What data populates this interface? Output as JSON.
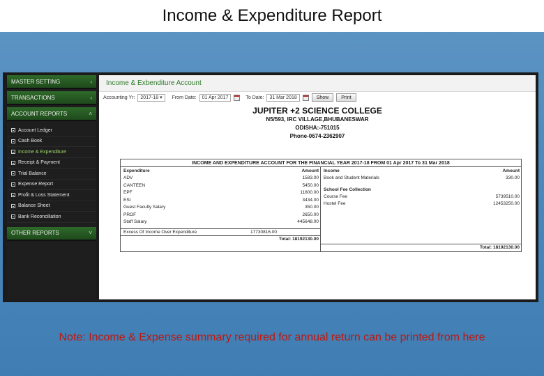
{
  "slide": {
    "title": "Income & Expenditure Report",
    "note": "Note: Income & Expense summary required for annual return can be printed from here"
  },
  "sidebar": {
    "sections": [
      {
        "label": "MASTER SETTING",
        "chevron": "chevron-right-icon"
      },
      {
        "label": "TRANSACTIONS",
        "chevron": "chevron-right-icon"
      },
      {
        "label": "ACCOUNT REPORTS",
        "chevron": "chevron-up-icon"
      }
    ],
    "items": [
      "Account Ledger",
      "Cash Book",
      "Income & Expenditure",
      "Receipt & Payment",
      "Trial Balance",
      "Expense Report",
      "Profit & Loss Statement",
      "Balance Sheet",
      "Bank Reconciliation"
    ],
    "active_item": "Income & Expenditure",
    "other": {
      "label": "OTHER REPORTS",
      "chevron": "chevron-down-icon"
    }
  },
  "page": {
    "title": "Income & Exbenditure Account"
  },
  "filters": {
    "accounting_yr_label": "Accounting Yr:",
    "accounting_yr_value": "2017-18",
    "from_label": "From Date:",
    "from_value": "01 Apr 2017",
    "to_label": "To Date:",
    "to_value": "31 Mar 2018",
    "show_label": "Show",
    "print_label": "Print"
  },
  "college": {
    "name": "JUPITER +2 SCIENCE COLLEGE",
    "address": "N5/593, IRC VILLAGE,BHUBANESWAR",
    "state": "ODISHA:-751015",
    "phone": "Phone-0674-2362907"
  },
  "report": {
    "title": "INCOME AND EXPENDITURE ACCOUNT FOR THE FINANCIAL YEAR 2017-18 FROM 01 Apr 2017 To 31 Mar 2018",
    "expenditure_header": "Expenditure",
    "income_header": "Income",
    "amount_header": "Amount",
    "expenditure": [
      {
        "name": "ADV",
        "amount": "1583.00"
      },
      {
        "name": "CANTEEN",
        "amount": "5450.00"
      },
      {
        "name": "EPF",
        "amount": "11800.00"
      },
      {
        "name": "ESI",
        "amount": "3434.00"
      },
      {
        "name": "Guest Faculty Salary",
        "amount": "350.00"
      },
      {
        "name": "PROF",
        "amount": "2650.00"
      },
      {
        "name": "Staff Salary",
        "amount": "445648.00"
      }
    ],
    "excess": {
      "name": "Excess Of Income Over Expenditure",
      "amount": "17730816.00"
    },
    "income": [
      {
        "name": "Book and Student Materials",
        "amount": "330.00"
      }
    ],
    "income_group": "School Fee Collection",
    "income_group_rows": [
      {
        "name": "Course Fee",
        "amount": "5739510.00"
      },
      {
        "name": "Hostel Fee",
        "amount": "12453250.00"
      }
    ],
    "total_expenditure": "Total: 18192130.00",
    "total_income": "Total: 18192130.00"
  }
}
